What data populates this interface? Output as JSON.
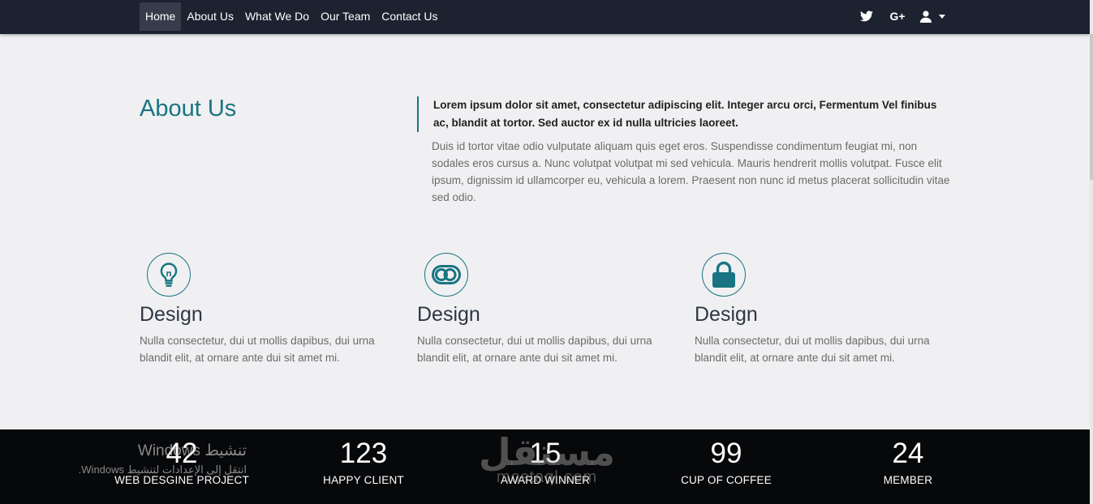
{
  "nav": {
    "links": [
      {
        "label": "Home",
        "active": true
      },
      {
        "label": "About Us",
        "active": false
      },
      {
        "label": "What We Do",
        "active": false
      },
      {
        "label": "Our Team",
        "active": false
      },
      {
        "label": "Contact Us",
        "active": false
      }
    ],
    "icons": [
      "twitter-icon",
      "google-plus-icon",
      "user-icon"
    ],
    "gplus_label": "G+"
  },
  "about": {
    "title": "About Us",
    "lead": "Lorem ipsum dolor sit amet, consectetur adipiscing elit. Integer arcu orci, Fermentum Vel finibus ac, blandit at tortor. Sed auctor ex id nulla ultricies laoreet.",
    "body": "Duis id tortor vitae odio vulputate aliquam quis eget eros. Suspendisse condimentum feugiat mi, non sodales eros cursus a. Nunc volutpat volutpat mi sed vehicula. Mauris hendrerit mollis volutpat. Fusce elit ipsum, dignissim id ullamcorper eu, vehicula a lorem. Praesent non nunc id metus placerat sollicitudin vitae sed odio."
  },
  "features": [
    {
      "icon": "lightbulb-icon",
      "title": "Design",
      "text": "Nulla consectetur, dui ut mollis dapibus, dui urna blandit elit, at ornare ante dui sit amet mi."
    },
    {
      "icon": "toggle-icon",
      "title": "Design",
      "text": "Nulla consectetur, dui ut mollis dapibus, dui urna blandit elit, at ornare ante dui sit amet mi."
    },
    {
      "icon": "lock-icon",
      "title": "Design",
      "text": "Nulla consectetur, dui ut mollis dapibus, dui urna blandit elit, at ornare ante dui sit amet mi."
    }
  ],
  "stats": [
    {
      "value": "42",
      "label": "WEB DESGINE PROJECT"
    },
    {
      "value": "123",
      "label": "HAPPY CLIENT"
    },
    {
      "value": "15",
      "label": "AWARD WINNER"
    },
    {
      "value": "99",
      "label": "CUP OF COFFEE"
    },
    {
      "value": "24",
      "label": "MEMBER"
    }
  ],
  "overlay": {
    "activation_title": "تنشيط Windows",
    "activation_sub": "انتقل إلى الإعدادات لتنشيط Windows.",
    "watermark_ar": "مستقل",
    "watermark_latin": "mostaql.com"
  },
  "colors": {
    "accent": "#187482",
    "navbar": "#1c2230",
    "stats_bg": "#07080a",
    "page_bg": "#f0f0f2"
  }
}
